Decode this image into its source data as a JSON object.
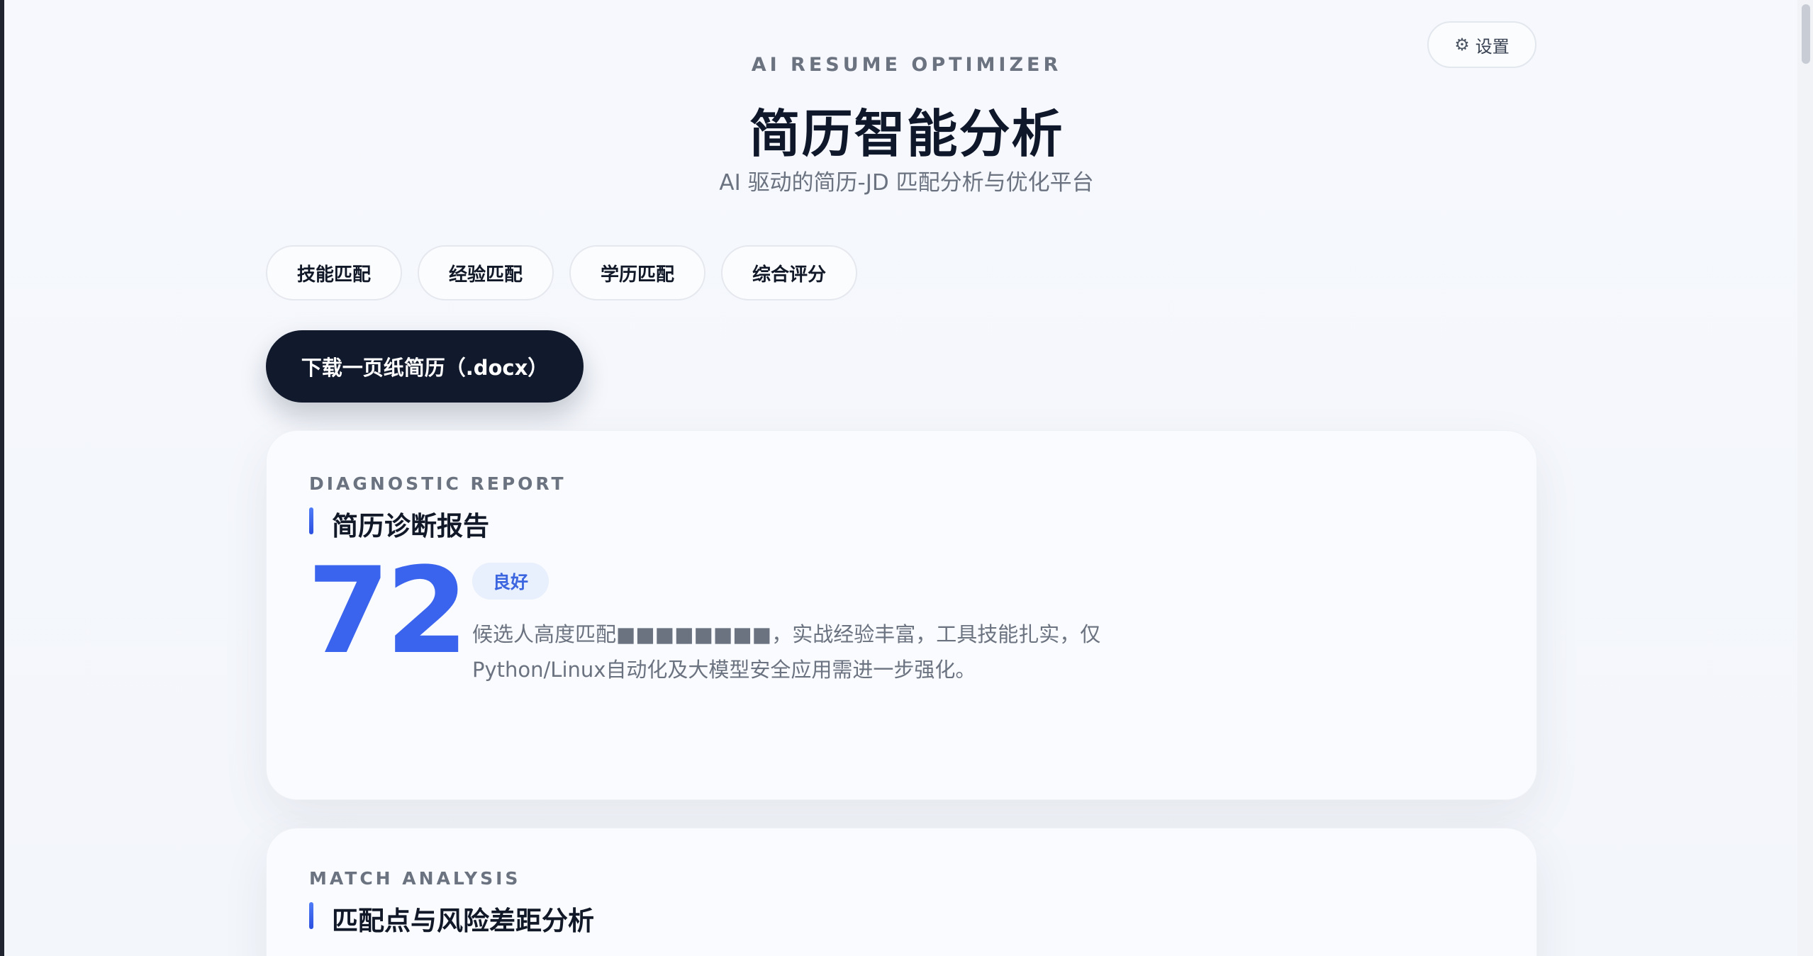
{
  "header": {
    "eyebrow": "AI RESUME OPTIMIZER",
    "title": "简历智能分析",
    "subtitle": "AI 驱动的简历-JD 匹配分析与优化平台",
    "settings_label": "设置"
  },
  "chips": [
    {
      "label": "技能匹配"
    },
    {
      "label": "经验匹配"
    },
    {
      "label": "学历匹配"
    },
    {
      "label": "综合评分"
    }
  ],
  "download": {
    "label": "下载一页纸简历（.docx）"
  },
  "diagnostic": {
    "eyebrow": "DIAGNOSTIC REPORT",
    "title": "简历诊断报告",
    "score": "72",
    "badge": "良好",
    "summary_line1": "候选人高度匹配■■■■■■■■，实战经验丰富，工具技能扎实，仅",
    "summary_line2": "Python/Linux自动化及大模型安全应用需进一步强化。"
  },
  "match": {
    "eyebrow": "MATCH ANALYSIS",
    "title": "匹配点与风险差距分析"
  },
  "icons": {
    "settings": "gear-icon"
  },
  "colors": {
    "accent": "#3b64ee",
    "dark": "#111a2c"
  }
}
